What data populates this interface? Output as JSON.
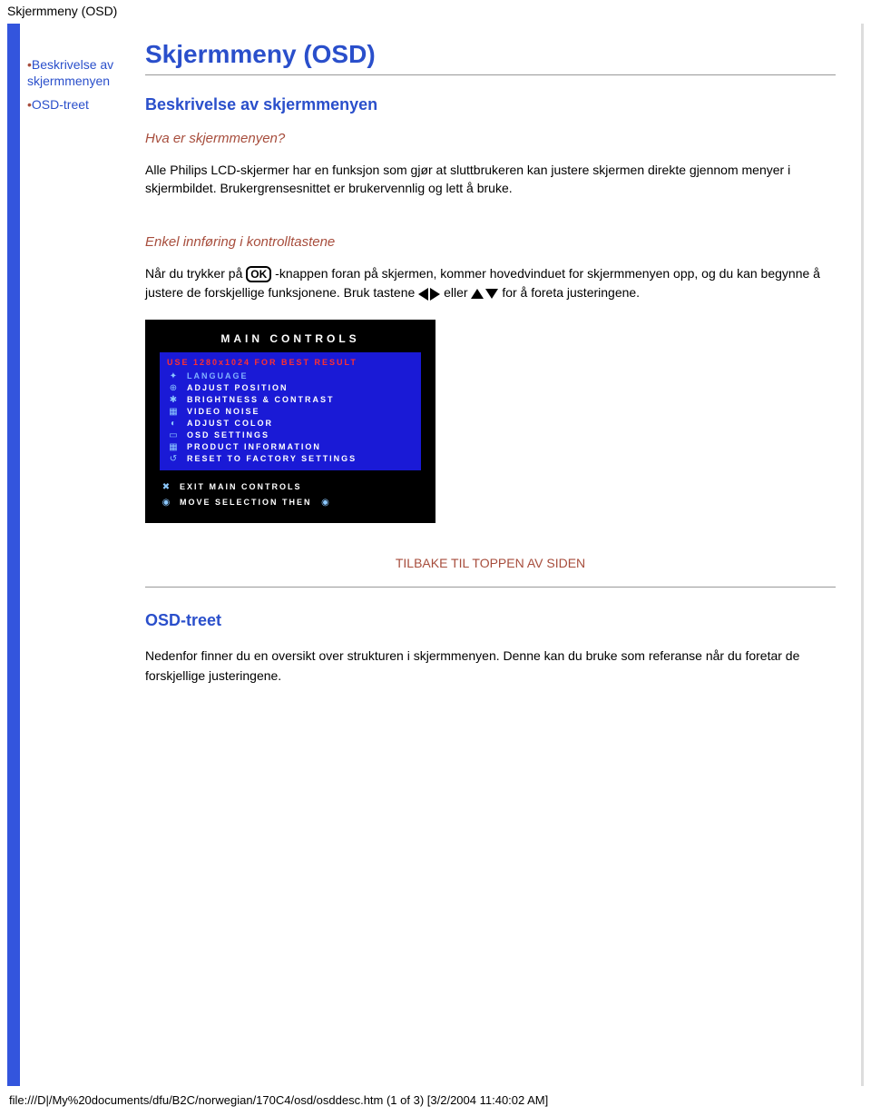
{
  "header": {
    "title": "Skjermmeny (OSD)"
  },
  "sidebar": {
    "items": [
      {
        "label": "Beskrivelse av skjermmenyen"
      },
      {
        "label": "OSD-treet"
      }
    ]
  },
  "main": {
    "title": "Skjermmeny (OSD)",
    "section1": {
      "heading": "Beskrivelse av skjermmenyen",
      "q": "Hva er skjermmenyen?",
      "para": "Alle Philips LCD-skjermer har en funksjon som gjør at sluttbrukeren kan justere skjermen direkte gjennom menyer i skjermbildet. Brukergrensesnittet er brukervennlig og lett å bruke.",
      "sub2": "Enkel innføring i kontrolltastene",
      "p2a": "Når du trykker på ",
      "p2b": " -knappen foran på skjermen, kommer hovedvinduet for skjermmenyen opp, og du kan begynne å justere de forskjellige funksjonene. Bruk tastene ",
      "p2c": " eller ",
      "p2d": " for å foreta justeringene."
    },
    "osd": {
      "title": "MAIN CONTROLS",
      "sub": "USE 1280x1024 FOR BEST RESULT",
      "items": [
        {
          "icon": "✦",
          "label": "LANGUAGE",
          "selected": true
        },
        {
          "icon": "⊕",
          "label": "ADJUST POSITION"
        },
        {
          "icon": "✱",
          "label": "BRIGHTNESS & CONTRAST"
        },
        {
          "icon": "▦",
          "label": "VIDEO NOISE"
        },
        {
          "icon": "◐",
          "label": "ADJUST COLOR"
        },
        {
          "icon": "▭",
          "label": "OSD SETTINGS"
        },
        {
          "icon": "▦",
          "label": "PRODUCT INFORMATION"
        },
        {
          "icon": "↺",
          "label": "RESET TO FACTORY SETTINGS"
        }
      ],
      "exit": {
        "icon": "✖",
        "label": "EXIT MAIN CONTROLS"
      },
      "move": {
        "icon": "◉",
        "label": "MOVE SELECTION THEN",
        "icon2": "◉"
      }
    },
    "back_link": "TILBAKE TIL TOPPEN AV SIDEN",
    "section2": {
      "heading": "OSD-treet",
      "para": "Nedenfor finner du en oversikt over strukturen i skjermmenyen. Denne kan du bruke som referanse når du foretar de forskjellige justeringene."
    }
  },
  "footer": {
    "path": "file:///D|/My%20documents/dfu/B2C/norwegian/170C4/osd/osddesc.htm (1 of 3) [3/2/2004 11:40:02 AM]"
  }
}
